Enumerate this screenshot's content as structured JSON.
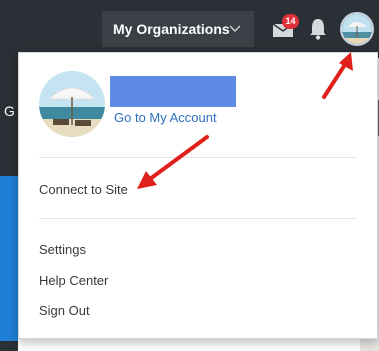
{
  "header": {
    "org_label": "My Organizations",
    "notification_count": "14"
  },
  "profile": {
    "account_link": "Go to My Account"
  },
  "menu": {
    "connect": "Connect to Site",
    "settings": "Settings",
    "help": "Help Center",
    "signout": "Sign Out"
  },
  "background": {
    "partial_letter": "G"
  },
  "colors": {
    "topbar": "#2b3036",
    "badge": "#e0303a",
    "link": "#2f6fc0",
    "redacted_name": "#5d8be6",
    "annotation_arrow": "#e0211b",
    "side_panel": "#1f7fd6"
  },
  "icons": {
    "org_dropdown": "chevron-down-icon",
    "notifications": "mail-icon",
    "alerts": "bell-icon",
    "avatar": "beach-umbrella-avatar"
  }
}
